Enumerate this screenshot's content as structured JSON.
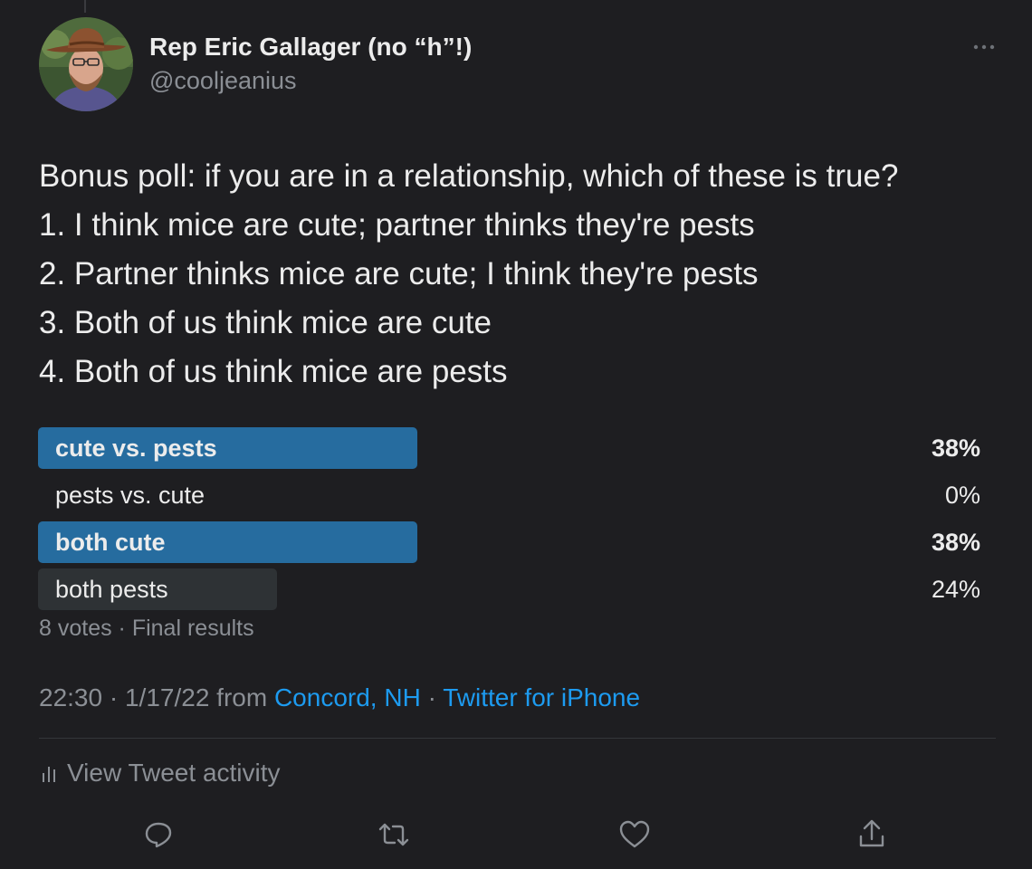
{
  "tweet": {
    "author": {
      "display_name": "Rep Eric Gallager (no “h”!)",
      "handle": "@cooljeanius",
      "avatar_icon": "user-avatar"
    },
    "more_icon": "more-horizontal-icon",
    "text_lines": [
      "Bonus poll: if you are in a relationship, which of these is true?",
      "1. I think mice are cute; partner thinks they're pests",
      "2. Partner thinks mice are cute; I think they're pests",
      "3. Both of us think mice are cute",
      "4. Both of us think mice are pests"
    ],
    "poll": {
      "options": [
        {
          "label": "cute vs. pests",
          "percent_text": "38%",
          "percent": 38,
          "winner": true
        },
        {
          "label": "pests vs. cute",
          "percent_text": "0%",
          "percent": 0,
          "winner": false
        },
        {
          "label": "both cute",
          "percent_text": "38%",
          "percent": 38,
          "winner": true
        },
        {
          "label": "both pests",
          "percent_text": "24%",
          "percent": 24,
          "winner": false
        }
      ],
      "votes": "8 votes",
      "separator": " · ",
      "status": "Final results"
    },
    "meta": {
      "time": "22:30",
      "date": "1/17/22",
      "from_text": "from",
      "location": "Concord, NH",
      "source": "Twitter for iPhone"
    },
    "activity_label": "View Tweet activity",
    "actions": [
      "reply-icon",
      "retweet-icon",
      "like-icon",
      "share-icon"
    ]
  },
  "colors": {
    "background": "#1e1e21",
    "text": "#ececec",
    "secondary_text": "#8b8f95",
    "link": "#1d9bf0",
    "poll_winner": "#266c9f",
    "poll_other": "#2e3235"
  }
}
